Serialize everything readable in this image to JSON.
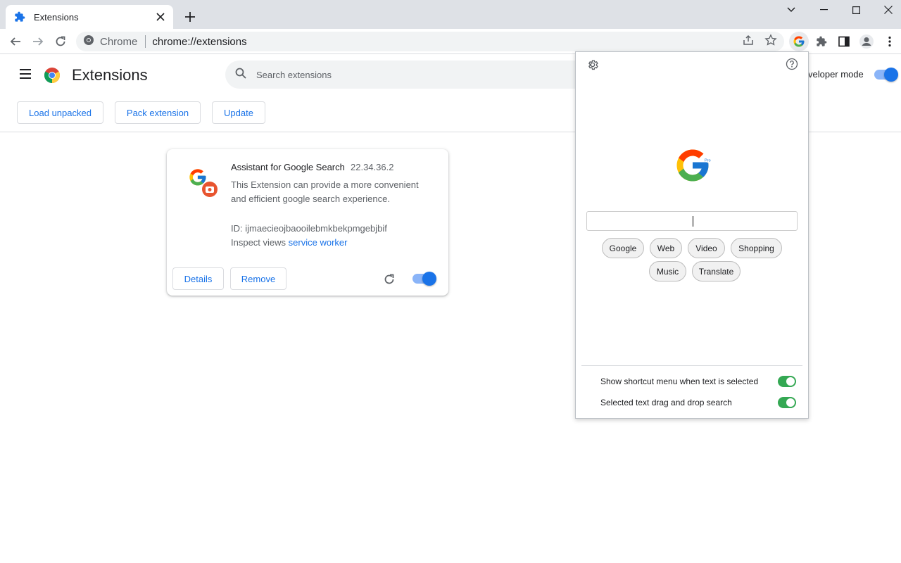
{
  "tab": {
    "title": "Extensions"
  },
  "omnibox": {
    "site_label": "Chrome",
    "url": "chrome://extensions"
  },
  "header": {
    "title": "Extensions",
    "search_placeholder": "Search extensions",
    "dev_mode_label": "veloper mode",
    "dev_mode_on": true
  },
  "actions": {
    "load_unpacked": "Load unpacked",
    "pack_extension": "Pack extension",
    "update": "Update"
  },
  "extension": {
    "name": "Assistant for Google Search",
    "version": "22.34.36.2",
    "description": "This Extension can provide a more convenient and efficient google search experience.",
    "id_text": "ID: ijmaecieojbaooilebmkbekpmgebjbif",
    "inspect_label": "Inspect views",
    "inspect_link": "service worker",
    "details_label": "Details",
    "remove_label": "Remove",
    "enabled": true
  },
  "popup": {
    "logo_badge": "Pro",
    "search_value": "",
    "chips": [
      "Google",
      "Web",
      "Video",
      "Shopping",
      "Music",
      "Translate"
    ],
    "options": [
      {
        "label": "Show shortcut menu when text is selected",
        "on": true
      },
      {
        "label": "Selected text drag and drop search",
        "on": true
      }
    ]
  },
  "colors": {
    "accent": "#1a73e8",
    "toggle_green": "#34a853"
  }
}
